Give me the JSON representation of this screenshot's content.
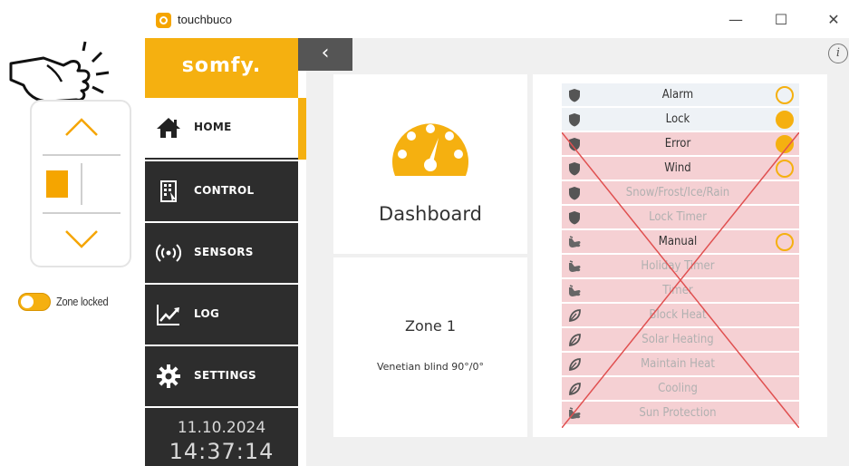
{
  "app": {
    "title": "touchbuco"
  },
  "window_controls": {
    "minimize": "—",
    "maximize": "☐",
    "close": "✕"
  },
  "brand": {
    "logo_text": "somfy."
  },
  "sidebar": {
    "items": [
      {
        "label": "HOME",
        "icon": "home-icon",
        "active": true
      },
      {
        "label": "CONTROL",
        "icon": "control-icon",
        "active": false
      },
      {
        "label": "SENSORS",
        "icon": "sensors-icon",
        "active": false
      },
      {
        "label": "LOG",
        "icon": "log-icon",
        "active": false
      },
      {
        "label": "SETTINGS",
        "icon": "gear-icon",
        "active": false
      }
    ],
    "date": "11.10.2024",
    "time": "14:37:14"
  },
  "nav": {
    "back": "‹",
    "info": "i"
  },
  "remote": {
    "zone_locked_label": "Zone locked",
    "zone_locked": true
  },
  "dashboard": {
    "label": "Dashboard"
  },
  "zone": {
    "title": "Zone 1",
    "subtitle": "Venetian blind 90°/0°"
  },
  "status": {
    "items": [
      {
        "label": "Alarm",
        "icon": "shield-icon",
        "indicator": "off",
        "crossed": false,
        "dim": false
      },
      {
        "label": "Lock",
        "icon": "shield-icon",
        "indicator": "on",
        "crossed": false,
        "dim": false
      },
      {
        "label": "Error",
        "icon": "shield-icon",
        "indicator": "on",
        "crossed": true,
        "dim": false
      },
      {
        "label": "Wind",
        "icon": "shield-icon",
        "indicator": "off",
        "crossed": true,
        "dim": false
      },
      {
        "label": "Snow/Frost/Ice/Rain",
        "icon": "shield-icon",
        "indicator": "none",
        "crossed": true,
        "dim": true
      },
      {
        "label": "Lock Timer",
        "icon": "shield-icon",
        "indicator": "none",
        "crossed": true,
        "dim": true
      },
      {
        "label": "Manual",
        "icon": "hand-icon",
        "indicator": "off",
        "crossed": true,
        "dim": false
      },
      {
        "label": "Holiday Timer",
        "icon": "hand-icon",
        "indicator": "none",
        "crossed": true,
        "dim": true
      },
      {
        "label": "Timer",
        "icon": "hand-icon",
        "indicator": "none",
        "crossed": true,
        "dim": true
      },
      {
        "label": "Block Heat",
        "icon": "leaf-icon",
        "indicator": "none",
        "crossed": true,
        "dim": true
      },
      {
        "label": "Solar Heating",
        "icon": "leaf-icon",
        "indicator": "none",
        "crossed": true,
        "dim": true
      },
      {
        "label": "Maintain Heat",
        "icon": "leaf-icon",
        "indicator": "none",
        "crossed": true,
        "dim": true
      },
      {
        "label": "Cooling",
        "icon": "leaf-icon",
        "indicator": "none",
        "crossed": true,
        "dim": true
      },
      {
        "label": "Sun Protection",
        "icon": "hand-icon",
        "indicator": "none",
        "crossed": true,
        "dim": true
      }
    ]
  },
  "colors": {
    "accent": "#f5b010",
    "sidebar": "#2d2d2d",
    "crossed_bg": "#f5d0d3",
    "cross_line": "#e05050"
  }
}
